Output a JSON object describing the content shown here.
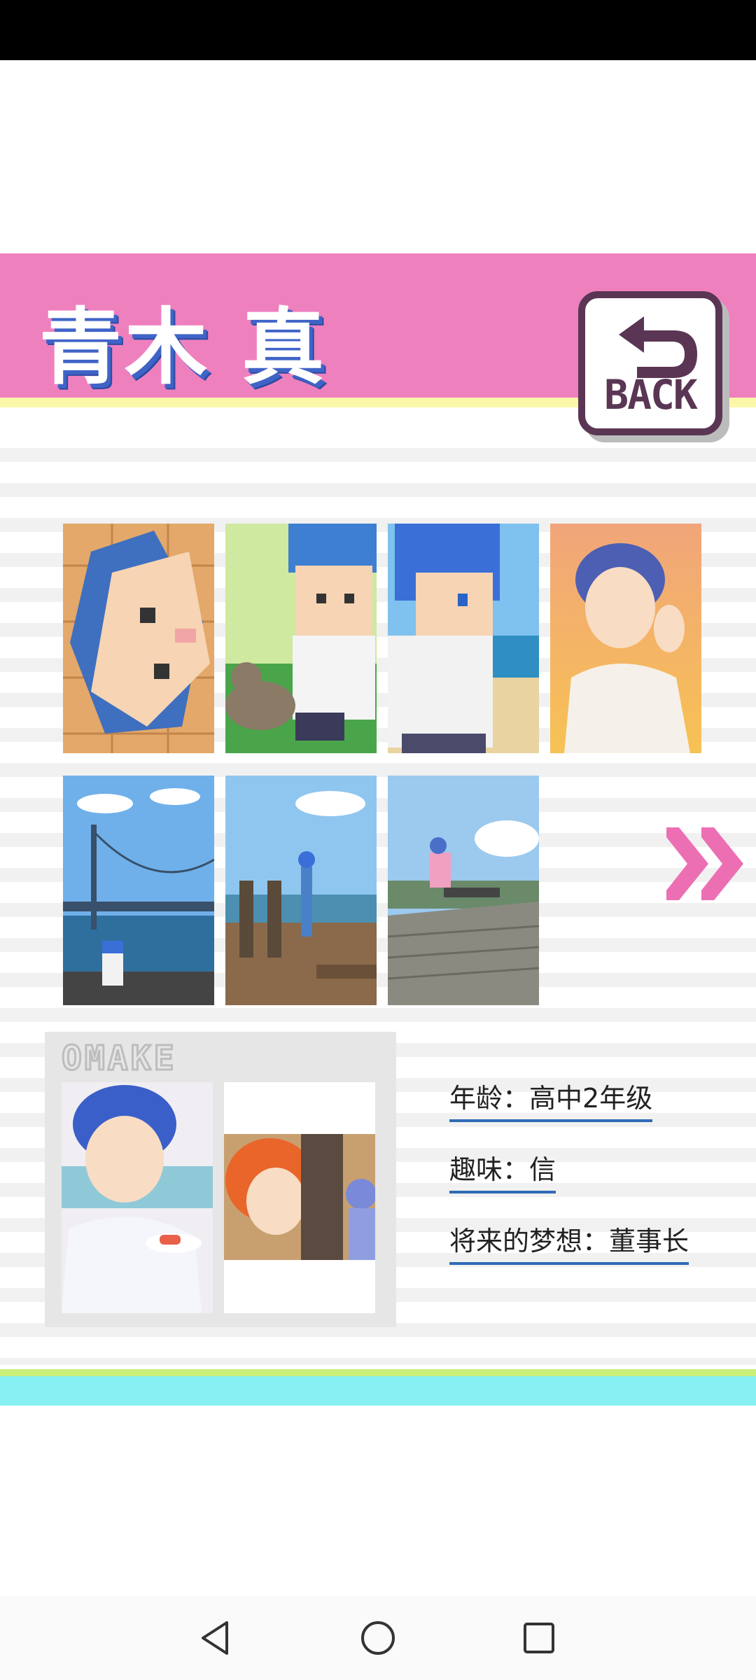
{
  "header": {
    "character_name": "青木 真",
    "back_label": "BACK"
  },
  "gallery": {
    "thumbnails": [
      {
        "id": 1,
        "icon": "pixel-face-on-wood-floor"
      },
      {
        "id": 2,
        "icon": "pixel-boy-with-cat-on-grass"
      },
      {
        "id": 3,
        "icon": "pixel-boy-at-beach"
      },
      {
        "id": 4,
        "icon": "anime-boy-at-sunset"
      },
      {
        "id": 5,
        "icon": "suspension-bridge-photo"
      },
      {
        "id": 6,
        "icon": "observation-deck-photo"
      },
      {
        "id": 7,
        "icon": "boy-sitting-on-boardwalk-photo"
      }
    ],
    "next_icon": "double-chevron-right"
  },
  "omake": {
    "label": "OMAKE",
    "images": [
      {
        "icon": "boy-eating-sushi"
      },
      {
        "icon": "two-boys-portrait"
      }
    ]
  },
  "profile": {
    "age_label": "年龄",
    "age_value": "高中2年级",
    "hobby_label": "趣味",
    "hobby_value": "信",
    "dream_label": "将来的梦想",
    "dream_value": "董事长",
    "separator": "："
  },
  "colors": {
    "header_pink": "#ef80be",
    "name_shadow_blue": "#3f63c7",
    "back_border": "#5a3654",
    "arrow_pink": "#ec6fb4",
    "underline_blue": "#2f6bb6",
    "footer_cyan": "#86f0f2",
    "footer_green": "#c9ef7a"
  }
}
